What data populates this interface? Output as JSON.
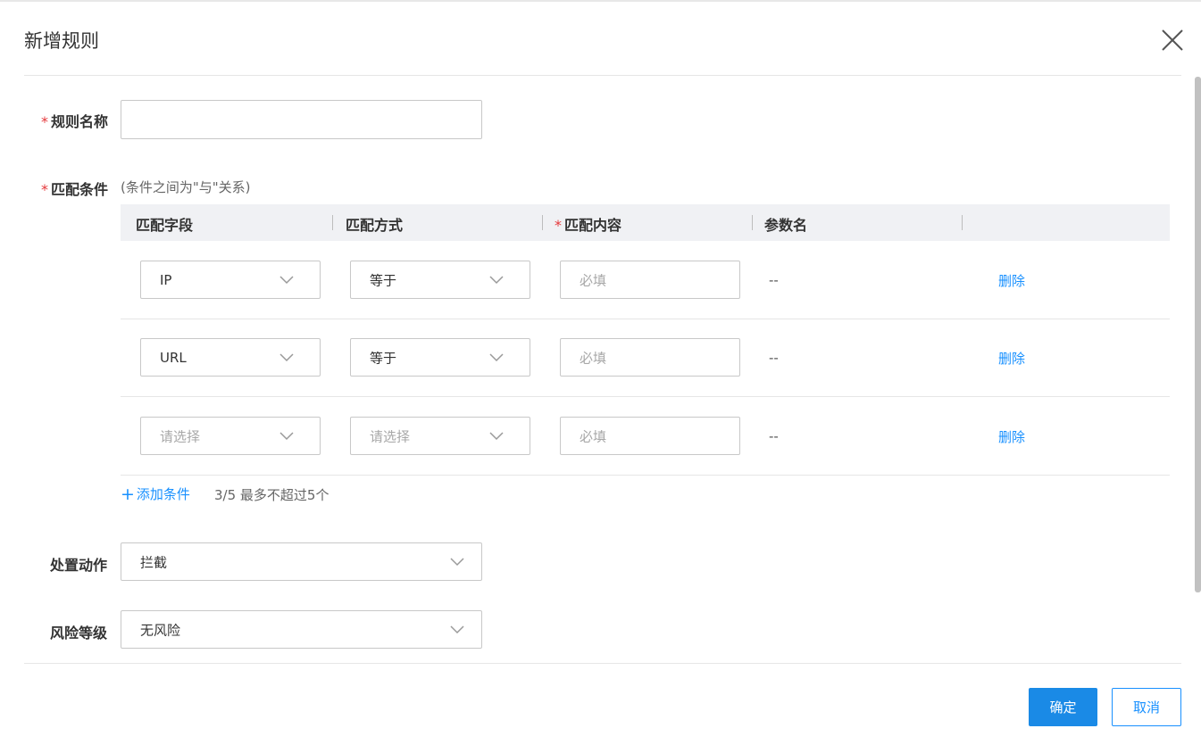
{
  "dialog": {
    "title": "新增规则"
  },
  "form": {
    "required_mark": "*",
    "rule_name": {
      "label": "规则名称",
      "value": ""
    },
    "conditions": {
      "label": "匹配条件",
      "hint": "(条件之间为\"与\"关系)",
      "columns": [
        "匹配字段",
        "匹配方式",
        "匹配内容",
        "参数名"
      ],
      "rows": [
        {
          "field": "IP",
          "field_placeholder": false,
          "method": "等于",
          "method_placeholder": false,
          "content_placeholder": "必填",
          "param": "--",
          "delete": "删除"
        },
        {
          "field": "URL",
          "field_placeholder": false,
          "method": "等于",
          "method_placeholder": false,
          "content_placeholder": "必填",
          "param": "--",
          "delete": "删除"
        },
        {
          "field": "请选择",
          "field_placeholder": true,
          "method": "请选择",
          "method_placeholder": true,
          "content_placeholder": "必填",
          "param": "--",
          "delete": "删除"
        }
      ],
      "add_label": "添加条件",
      "add_symbol": "+",
      "count_text": "3/5 最多不超过5个"
    },
    "action": {
      "label": "处置动作",
      "value": "拦截"
    },
    "risk": {
      "label": "风险等级",
      "value": "无风险"
    }
  },
  "footer": {
    "confirm": "确定",
    "cancel": "取消"
  },
  "colors": {
    "primary": "#1a8ae6",
    "link": "#1890ff",
    "required": "#e5383b",
    "header_bg": "#f0f1f4"
  },
  "icons": {
    "close": "close-icon",
    "dropdown": "chevron-down-icon"
  }
}
